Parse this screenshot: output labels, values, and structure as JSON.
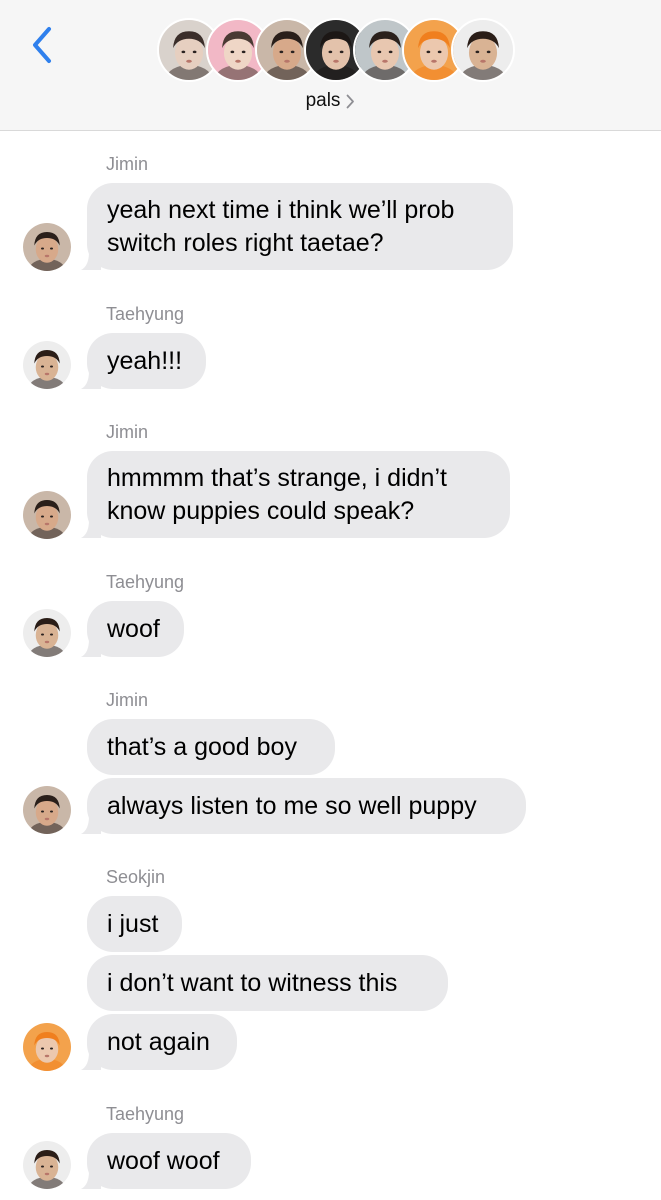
{
  "header": {
    "group_name": "pals",
    "back_icon": "chevron-left-icon",
    "accent_color": "#2f80ed",
    "members": [
      {
        "skin": "#e6cfc0",
        "hair": "#3b2e2a",
        "bg": "#d9d2cc"
      },
      {
        "skin": "#efd6c6",
        "hair": "#4a3a33",
        "bg": "#f2b8c6"
      },
      {
        "skin": "#d7a98a",
        "hair": "#2a1f1a",
        "bg": "#c9b7a8"
      },
      {
        "skin": "#e3c2ab",
        "hair": "#1c1715",
        "bg": "#2b2b2b"
      },
      {
        "skin": "#e8c7b0",
        "hair": "#2b211c",
        "bg": "#bfc6c9"
      },
      {
        "skin": "#ecc8ae",
        "hair": "#f07f1e",
        "bg": "#f3a24c"
      },
      {
        "skin": "#d9b394",
        "hair": "#2a1d17",
        "bg": "#ededed"
      }
    ]
  },
  "messages": {
    "bubble_color": "#e9e9eb",
    "blocks": [
      {
        "sender": "Jimin",
        "bubbles": [
          "yeah next time i think we’ll prob\nswitch roles right taetae?"
        ]
      },
      {
        "sender": "Taehyung",
        "bubbles": [
          "yeah!!!"
        ]
      },
      {
        "sender": "Jimin",
        "bubbles": [
          "hmmmm that’s strange, i didn’t\nknow puppies could speak?"
        ]
      },
      {
        "sender": "Taehyung",
        "bubbles": [
          "woof"
        ]
      },
      {
        "sender": "Jimin",
        "bubbles": [
          "that’s a good boy",
          "always listen to me so well puppy"
        ]
      },
      {
        "sender": "Seokjin",
        "bubbles": [
          "i just",
          "i don’t want to witness this",
          "not again"
        ]
      },
      {
        "sender": "Taehyung",
        "bubbles": [
          "woof woof"
        ]
      }
    ]
  }
}
